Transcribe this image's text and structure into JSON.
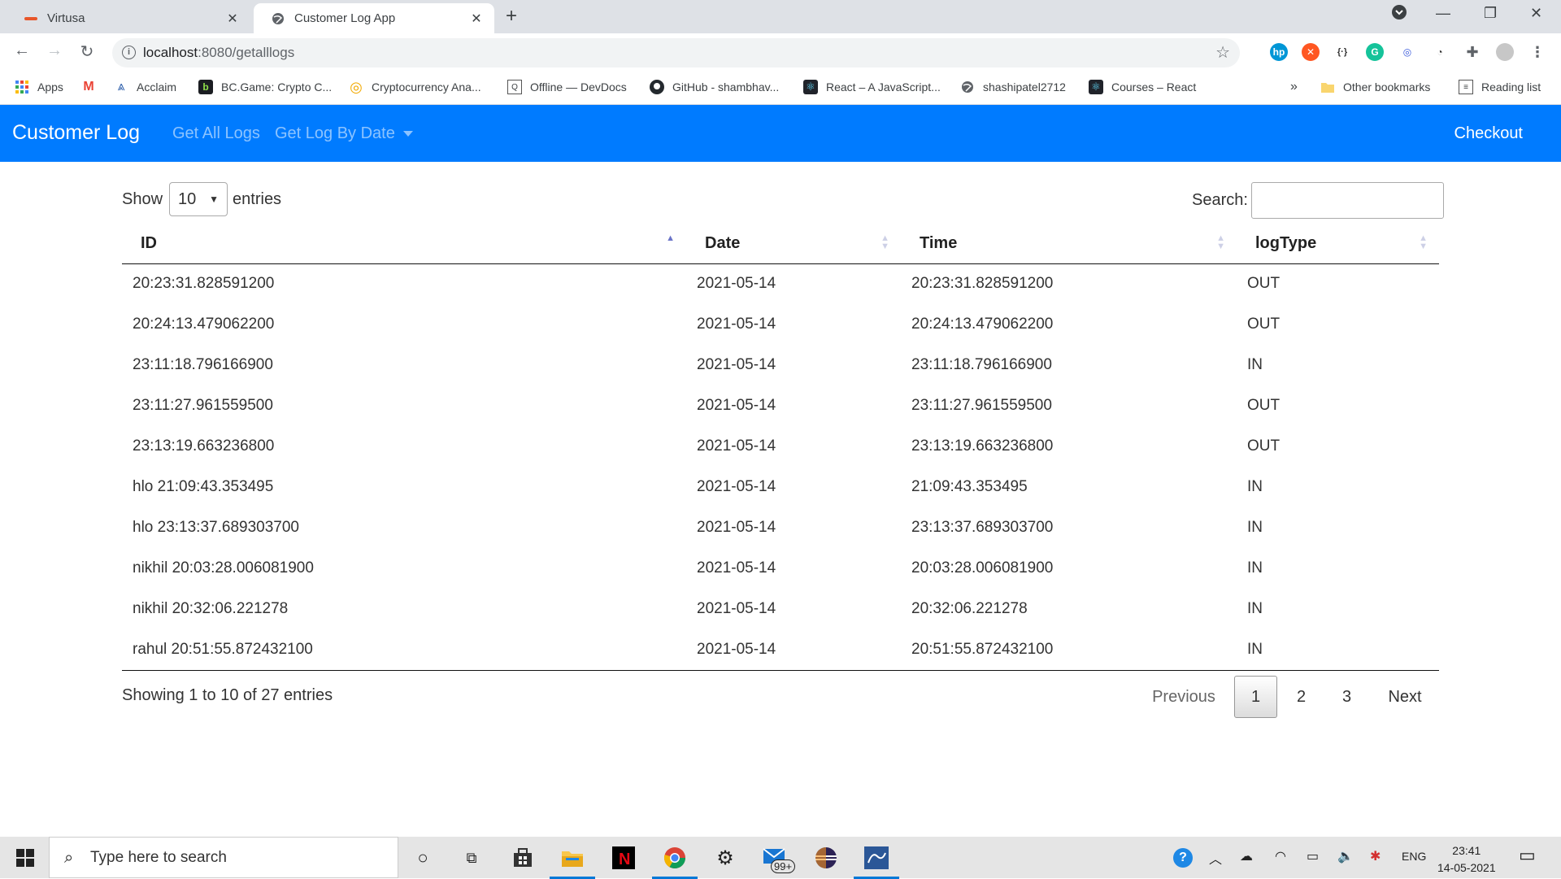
{
  "browser": {
    "tabs": [
      {
        "title": "Virtusa",
        "active": false
      },
      {
        "title": "Customer Log App",
        "active": true
      }
    ],
    "address": {
      "host": "localhost",
      "path": ":8080/getalllogs"
    },
    "bookmarks": [
      {
        "label": "Apps",
        "icon": "apps-grid-icon"
      },
      {
        "label": "",
        "icon": "gmail-icon"
      },
      {
        "label": "Acclaim",
        "icon": "acclaim-icon"
      },
      {
        "label": "BC.Game: Crypto C...",
        "icon": "bcgame-icon"
      },
      {
        "label": "Cryptocurrency Ana...",
        "icon": "crypto-icon"
      },
      {
        "label": "Offline — DevDocs",
        "icon": "devdocs-icon"
      },
      {
        "label": "GitHub - shambhav...",
        "icon": "github-icon"
      },
      {
        "label": "React – A JavaScript...",
        "icon": "react-icon"
      },
      {
        "label": "shashipatel2712",
        "icon": "globe-icon"
      },
      {
        "label": "Courses – React",
        "icon": "react-icon"
      }
    ],
    "overflow": "»",
    "other_bookmarks": "Other bookmarks",
    "reading_list": "Reading list"
  },
  "navbar": {
    "brand": "Customer Log",
    "links": [
      "Get All Logs",
      "Get Log By Date"
    ],
    "checkout": "Checkout"
  },
  "table_controls": {
    "show_label": "Show",
    "entries_value": "10",
    "entries_label": "entries",
    "search_label": "Search:",
    "search_value": ""
  },
  "table": {
    "columns": [
      "ID",
      "Date",
      "Time",
      "logType"
    ],
    "sorted_column": "ID",
    "rows": [
      [
        "20:23:31.828591200",
        "2021-05-14",
        "20:23:31.828591200",
        "OUT"
      ],
      [
        "20:24:13.479062200",
        "2021-05-14",
        "20:24:13.479062200",
        "OUT"
      ],
      [
        "23:11:18.796166900",
        "2021-05-14",
        "23:11:18.796166900",
        "IN"
      ],
      [
        "23:11:27.961559500",
        "2021-05-14",
        "23:11:27.961559500",
        "OUT"
      ],
      [
        "23:13:19.663236800",
        "2021-05-14",
        "23:13:19.663236800",
        "OUT"
      ],
      [
        "hlo 21:09:43.353495",
        "2021-05-14",
        "21:09:43.353495",
        "IN"
      ],
      [
        "hlo 23:13:37.689303700",
        "2021-05-14",
        "23:13:37.689303700",
        "IN"
      ],
      [
        "nikhil 20:03:28.006081900",
        "2021-05-14",
        "20:03:28.006081900",
        "IN"
      ],
      [
        "nikhil 20:32:06.221278",
        "2021-05-14",
        "20:32:06.221278",
        "IN"
      ],
      [
        "rahul 20:51:55.872432100",
        "2021-05-14",
        "20:51:55.872432100",
        "IN"
      ]
    ]
  },
  "pagination": {
    "info": "Showing 1 to 10 of 27 entries",
    "previous": "Previous",
    "pages": [
      "1",
      "2",
      "3"
    ],
    "current": "1",
    "next": "Next"
  },
  "taskbar": {
    "search_placeholder": "Type here to search",
    "mail_badge": "99+",
    "lang": "ENG",
    "time": "23:41",
    "date": "14-05-2021"
  },
  "colors": {
    "navbar": "#007bff",
    "tabstrip": "#dee1e6",
    "taskbar": "#e5e5e5"
  }
}
